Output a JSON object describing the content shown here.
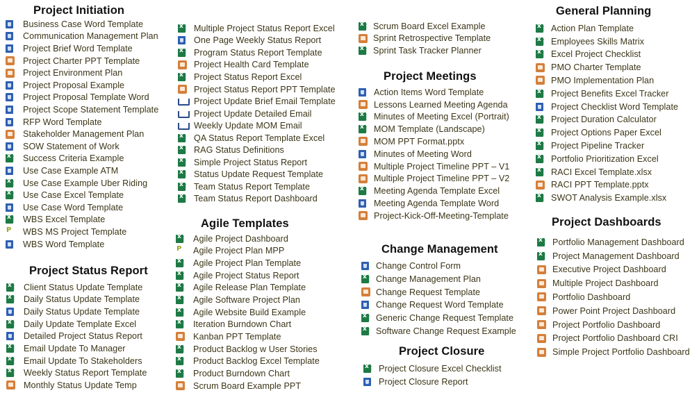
{
  "sections": [
    {
      "id": "project-initiation",
      "title": "Project Initiation",
      "items": [
        {
          "label": "Business Case Word Template",
          "icon": "word-icon",
          "type": "word"
        },
        {
          "label": "Communication Management Plan",
          "icon": "word-icon",
          "type": "word"
        },
        {
          "label": "Project Brief Word Template",
          "icon": "word-icon",
          "type": "word"
        },
        {
          "label": "Project Charter PPT Template",
          "icon": "powerpoint-icon",
          "type": "ppt"
        },
        {
          "label": "Project Environment Plan",
          "icon": "powerpoint-icon",
          "type": "ppt"
        },
        {
          "label": "Project Proposal Example",
          "icon": "word-icon",
          "type": "word"
        },
        {
          "label": "Project Proposal Template Word",
          "icon": "word-icon",
          "type": "word"
        },
        {
          "label": "Project Scope Statement Template",
          "icon": "word-icon",
          "type": "word"
        },
        {
          "label": "RFP Word Template",
          "icon": "word-icon",
          "type": "word"
        },
        {
          "label": "Stakeholder Management Plan",
          "icon": "powerpoint-icon",
          "type": "ppt"
        },
        {
          "label": "SOW Statement of Work",
          "icon": "word-icon",
          "type": "word"
        },
        {
          "label": "Success Criteria Example",
          "icon": "excel-icon",
          "type": "excel"
        },
        {
          "label": "Use Case Example ATM",
          "icon": "word-icon",
          "type": "word"
        },
        {
          "label": "Use Case Example Uber Riding",
          "icon": "excel-icon",
          "type": "excel"
        },
        {
          "label": "Use Case Excel Template",
          "icon": "excel-icon",
          "type": "excel"
        },
        {
          "label": "Use Case Word Template",
          "icon": "word-icon",
          "type": "word"
        },
        {
          "label": "WBS Excel Template",
          "icon": "excel-icon",
          "type": "excel"
        },
        {
          "label": "WBS MS Project Template",
          "icon": "ms-project-icon",
          "type": "project"
        },
        {
          "label": "WBS Word Template",
          "icon": "word-icon",
          "type": "word"
        }
      ]
    },
    {
      "id": "project-status-report",
      "title": "Project Status Report",
      "items": [
        {
          "label": "Client Status Update Template",
          "icon": "excel-icon",
          "type": "excel"
        },
        {
          "label": "Daily Status Update Template",
          "icon": "excel-icon",
          "type": "excel"
        },
        {
          "label": "Daily Status Update Template",
          "icon": "word-icon",
          "type": "word"
        },
        {
          "label": "Daily Update Template Excel",
          "icon": "excel-icon",
          "type": "excel"
        },
        {
          "label": "Detailed Project Status Report",
          "icon": "word-icon",
          "type": "word"
        },
        {
          "label": "Email Update To Manager",
          "icon": "excel-icon",
          "type": "excel"
        },
        {
          "label": "Email Update To Stakeholders",
          "icon": "excel-icon",
          "type": "excel"
        },
        {
          "label": "Weekly Status Report Template",
          "icon": "excel-icon",
          "type": "excel"
        },
        {
          "label": "Monthly Status Update Temp",
          "icon": "powerpoint-icon",
          "type": "ppt"
        },
        {
          "label": "Multiple Project Status Report Excel",
          "icon": "excel-icon",
          "type": "excel"
        },
        {
          "label": "One Page Weekly Status Report",
          "icon": "word-icon",
          "type": "word"
        },
        {
          "label": "Program Status Report Template",
          "icon": "excel-icon",
          "type": "excel"
        },
        {
          "label": "Project Health Card Template",
          "icon": "powerpoint-icon",
          "type": "ppt"
        },
        {
          "label": "Project Status Report Excel",
          "icon": "excel-icon",
          "type": "excel"
        },
        {
          "label": "Project Status Report PPT Template",
          "icon": "powerpoint-icon",
          "type": "ppt"
        },
        {
          "label": "Project Update Brief Email Template",
          "icon": "email-icon",
          "type": "email"
        },
        {
          "label": "Project Update Detailed Email",
          "icon": "email-icon",
          "type": "email"
        },
        {
          "label": "Weekly Update MOM Email",
          "icon": "email-icon",
          "type": "email"
        },
        {
          "label": "QA Status Report Template Excel",
          "icon": "excel-icon",
          "type": "excel"
        },
        {
          "label": "RAG Status Definitions",
          "icon": "excel-icon",
          "type": "excel"
        },
        {
          "label": "Simple Project Status Report",
          "icon": "excel-icon",
          "type": "excel"
        },
        {
          "label": "Status Update Request Template",
          "icon": "excel-icon",
          "type": "excel"
        },
        {
          "label": "Team Status Report Template",
          "icon": "excel-icon",
          "type": "excel"
        },
        {
          "label": "Team Status Report Dashboard",
          "icon": "excel-icon",
          "type": "excel"
        }
      ]
    },
    {
      "id": "agile-templates",
      "title": "Agile Templates",
      "items": [
        {
          "label": "Agile Project Dashboard",
          "icon": "excel-icon",
          "type": "excel"
        },
        {
          "label": "Agile Project Plan MPP",
          "icon": "ms-project-icon",
          "type": "project"
        },
        {
          "label": "Agile Project Plan Template",
          "icon": "excel-icon",
          "type": "excel"
        },
        {
          "label": "Agile Project Status Report",
          "icon": "excel-icon",
          "type": "excel"
        },
        {
          "label": "Agile Release Plan Template",
          "icon": "excel-icon",
          "type": "excel"
        },
        {
          "label": "Agile Software Project Plan",
          "icon": "excel-icon",
          "type": "excel"
        },
        {
          "label": "Agile Website Build Example",
          "icon": "excel-icon",
          "type": "excel"
        },
        {
          "label": "Iteration Burndown Chart",
          "icon": "excel-icon",
          "type": "excel"
        },
        {
          "label": "Kanban PPT Template",
          "icon": "powerpoint-icon",
          "type": "ppt"
        },
        {
          "label": "Product Backlog w User Stories",
          "icon": "excel-icon",
          "type": "excel"
        },
        {
          "label": "Product Backlog Excel Template",
          "icon": "excel-icon",
          "type": "excel"
        },
        {
          "label": "Product Burndown Chart",
          "icon": "excel-icon",
          "type": "excel"
        },
        {
          "label": "Scrum Board Example PPT",
          "icon": "powerpoint-icon",
          "type": "ppt"
        },
        {
          "label": "Scrum Board Excel Example",
          "icon": "excel-icon",
          "type": "excel"
        },
        {
          "label": "Sprint Retrospective Template",
          "icon": "powerpoint-icon",
          "type": "ppt"
        },
        {
          "label": "Sprint Task Tracker Planner",
          "icon": "excel-icon",
          "type": "excel"
        }
      ]
    },
    {
      "id": "project-meetings",
      "title": "Project Meetings",
      "items": [
        {
          "label": "Action Items Word Template",
          "icon": "word-icon",
          "type": "word"
        },
        {
          "label": "Lessons Learned Meeting Agenda",
          "icon": "powerpoint-icon",
          "type": "ppt"
        },
        {
          "label": "Minutes of Meeting Excel (Portrait)",
          "icon": "excel-icon",
          "type": "excel"
        },
        {
          "label": "MOM Template (Landscape)",
          "icon": "excel-icon",
          "type": "excel"
        },
        {
          "label": "MOM PPT Format.pptx",
          "icon": "powerpoint-icon",
          "type": "ppt"
        },
        {
          "label": "Minutes of Meeting Word",
          "icon": "word-icon",
          "type": "word"
        },
        {
          "label": "Multiple Project Timeline PPT – V1",
          "icon": "powerpoint-icon",
          "type": "ppt"
        },
        {
          "label": "Multiple Project Timeline PPT – V2",
          "icon": "powerpoint-icon",
          "type": "ppt"
        },
        {
          "label": "Meeting Agenda Template Excel",
          "icon": "excel-icon",
          "type": "excel"
        },
        {
          "label": "Meeting Agenda Template Word",
          "icon": "word-icon",
          "type": "word"
        },
        {
          "label": "Project-Kick-Off-Meeting-Template",
          "icon": "powerpoint-icon",
          "type": "ppt"
        }
      ]
    },
    {
      "id": "change-management",
      "title": "Change Management",
      "items": [
        {
          "label": "Change Control Form",
          "icon": "word-icon",
          "type": "word"
        },
        {
          "label": "Change Management Plan",
          "icon": "excel-icon",
          "type": "excel"
        },
        {
          "label": "Change Request Template",
          "icon": "powerpoint-icon",
          "type": "ppt"
        },
        {
          "label": "Change Request Word Template",
          "icon": "word-icon",
          "type": "word"
        },
        {
          "label": "Generic Change Request Template",
          "icon": "excel-icon",
          "type": "excel"
        },
        {
          "label": "Software Change Request Example",
          "icon": "excel-icon",
          "type": "excel"
        }
      ]
    },
    {
      "id": "project-closure",
      "title": "Project Closure",
      "items": [
        {
          "label": "Project Closure Excel Checklist",
          "icon": "excel-icon",
          "type": "excel"
        },
        {
          "label": "Project Closure Report",
          "icon": "word-icon",
          "type": "word"
        }
      ]
    },
    {
      "id": "general-planning",
      "title": "General Planning",
      "items": [
        {
          "label": "Action Plan Template",
          "icon": "excel-icon",
          "type": "excel"
        },
        {
          "label": "Employees Skills Matrix",
          "icon": "excel-icon",
          "type": "excel"
        },
        {
          "label": "Excel Project Checklist",
          "icon": "excel-icon",
          "type": "excel"
        },
        {
          "label": "PMO Charter Template",
          "icon": "powerpoint-icon",
          "type": "ppt"
        },
        {
          "label": "PMO Implementation Plan",
          "icon": "powerpoint-icon",
          "type": "ppt"
        },
        {
          "label": "Project Benefits Excel Tracker",
          "icon": "excel-icon",
          "type": "excel"
        },
        {
          "label": "Project Checklist Word Template",
          "icon": "word-icon",
          "type": "word"
        },
        {
          "label": "Project Duration Calculator",
          "icon": "excel-icon",
          "type": "excel"
        },
        {
          "label": "Project Options Paper Excel",
          "icon": "excel-icon",
          "type": "excel"
        },
        {
          "label": "Project Pipeline Tracker",
          "icon": "excel-icon",
          "type": "excel"
        },
        {
          "label": "Portfolio Prioritization Excel",
          "icon": "excel-icon",
          "type": "excel"
        },
        {
          "label": "RACI Excel Template.xlsx",
          "icon": "excel-icon",
          "type": "excel"
        },
        {
          "label": "RACI PPT Template.pptx",
          "icon": "powerpoint-icon",
          "type": "ppt"
        },
        {
          "label": "SWOT Analysis Example.xlsx",
          "icon": "excel-icon",
          "type": "excel"
        }
      ]
    },
    {
      "id": "project-dashboards",
      "title": "Project Dashboards",
      "items": [
        {
          "label": "Portfolio Management Dashboard",
          "icon": "excel-icon",
          "type": "excel"
        },
        {
          "label": "Project Management Dashboard",
          "icon": "excel-icon",
          "type": "excel"
        },
        {
          "label": "Executive Project Dashboard",
          "icon": "powerpoint-icon",
          "type": "ppt"
        },
        {
          "label": "Multiple Project Dashboard",
          "icon": "powerpoint-icon",
          "type": "ppt"
        },
        {
          "label": "Portfolio Dashboard",
          "icon": "powerpoint-icon",
          "type": "ppt"
        },
        {
          "label": "Power Point Project Dashboard",
          "icon": "powerpoint-icon",
          "type": "ppt"
        },
        {
          "label": "Project Portfolio Dashboard",
          "icon": "powerpoint-icon",
          "type": "ppt"
        },
        {
          "label": "Project Portfolio Dashboard CRI",
          "icon": "powerpoint-icon",
          "type": "ppt"
        },
        {
          "label": "Simple Project Portfolio Dashboard",
          "icon": "powerpoint-icon",
          "type": "ppt"
        }
      ]
    }
  ]
}
